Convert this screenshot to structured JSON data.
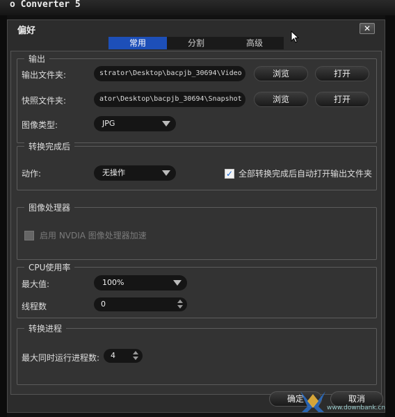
{
  "background_window": {
    "title": "o Converter 5"
  },
  "dialog": {
    "title": "偏好",
    "close_label": "✕",
    "tabs": [
      {
        "label": "常用",
        "active": true
      },
      {
        "label": "分割",
        "active": false
      },
      {
        "label": "高级",
        "active": false
      }
    ]
  },
  "output": {
    "legend": "输出",
    "output_folder_label": "输出文件夹:",
    "output_folder_value": "strator\\Desktop\\bacpjb_30694\\Video",
    "snapshot_folder_label": "快照文件夹:",
    "snapshot_folder_value": "ator\\Desktop\\bacpjb_30694\\Snapshot",
    "browse_label": "浏览",
    "open_label": "打开",
    "image_type_label": "图像类型:",
    "image_type_value": "JPG"
  },
  "after_convert": {
    "legend": "转换完成后",
    "action_label": "动作:",
    "action_value": "无操作",
    "auto_open_label": "全部转换完成后自动打开输出文件夹",
    "auto_open_checked": true
  },
  "gpu": {
    "legend": "图像处理器",
    "nvidia_label": "启用 NVDIA 图像处理器加速",
    "nvidia_enabled": false
  },
  "cpu": {
    "legend": "CPU使用率",
    "max_label": "最大值:",
    "max_value": "100%",
    "threads_label": "线程数",
    "threads_value": "0"
  },
  "process": {
    "legend": "转换进程",
    "max_concurrent_label": "最大同时运行进程数:",
    "max_concurrent_value": "4"
  },
  "footer": {
    "ok_label": "确定",
    "cancel_label": "取消"
  },
  "watermark": {
    "text": "www.downbank.cn"
  },
  "colors": {
    "accent_tab": "#1d4fb8",
    "dialog_bg": "#2c2c2c",
    "check_blue": "#1a6ad8"
  }
}
